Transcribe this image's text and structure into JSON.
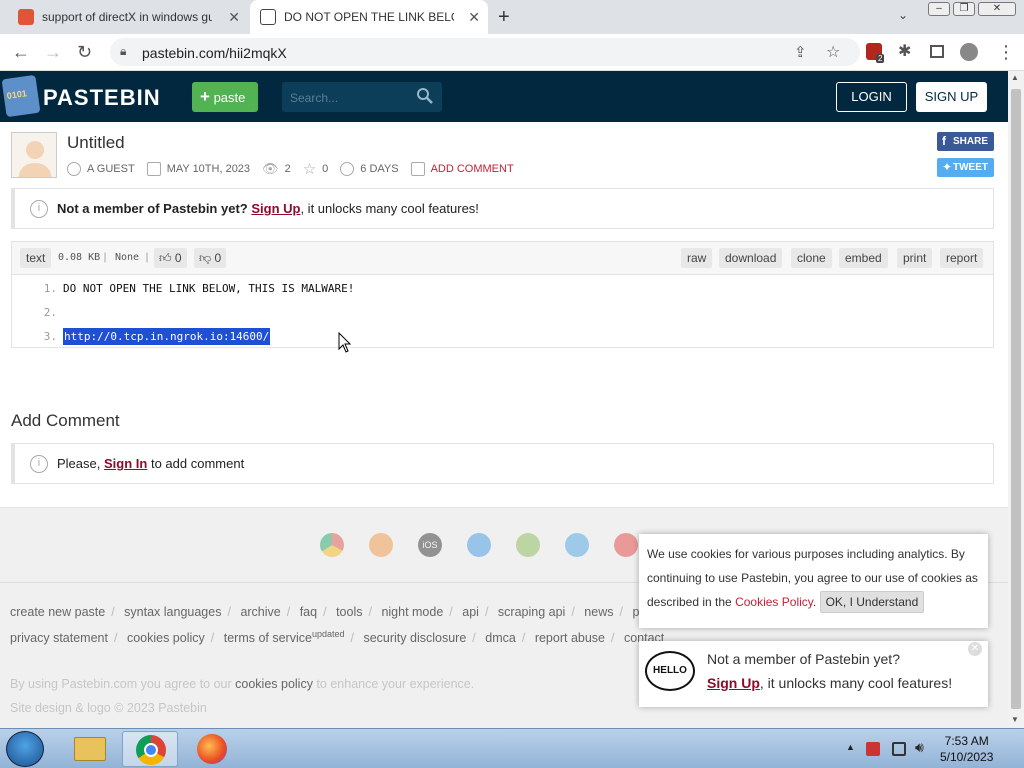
{
  "browser": {
    "tabs": [
      {
        "title": "support of directX in windows gu",
        "active": false
      },
      {
        "title": "DO NOT OPEN THE LINK BELOW, T",
        "active": true
      }
    ],
    "new_tab": "+",
    "url": "pastebin.com/hii2mqkX",
    "extension_badge": "2"
  },
  "header": {
    "logo": "PASTEBIN",
    "paste_button": "paste",
    "search_placeholder": "Search...",
    "login": "LOGIN",
    "signup": "SIGN UP"
  },
  "paste": {
    "title": "Untitled",
    "author": "A GUEST",
    "date": "MAY 10TH, 2023",
    "views": "2",
    "stars": "0",
    "expires": "6 DAYS",
    "add_comment": "ADD COMMENT",
    "share": "SHARE",
    "tweet": "TWEET",
    "syntax": "text",
    "size": "0.08 KB",
    "category": "None",
    "likes": "0",
    "dislikes": "0",
    "actions": [
      "raw",
      "download",
      "clone",
      "embed",
      "print",
      "report"
    ],
    "lines": [
      {
        "num": "1.",
        "text": "DO NOT OPEN THE LINK BELOW, THIS IS MALWARE!"
      },
      {
        "num": "2.",
        "text": ""
      },
      {
        "num": "3.",
        "text": "http://0.tcp.in.ngrok.io:14600/"
      }
    ]
  },
  "notice": {
    "bold": "Not a member of Pastebin yet?",
    "link": "Sign Up",
    "rest": ", it unlocks many cool features!"
  },
  "comments": {
    "heading": "Add Comment",
    "please": "Please,",
    "signin": "Sign In",
    "rest": "to add comment"
  },
  "footer": {
    "links_row1": [
      "create new paste",
      "syntax languages",
      "archive",
      "faq",
      "tools",
      "night mode",
      "api",
      "scraping api",
      "news",
      "pro"
    ],
    "links_row2": [
      "privacy statement",
      "cookies policy",
      "terms of service",
      "security disclosure",
      "dmca",
      "report abuse",
      "contact"
    ],
    "updated_sup": "updated",
    "agree_pre": "By using Pastebin.com you agree to our",
    "agree_link": "cookies policy",
    "agree_post": "to enhance your experience.",
    "copyright": "Site design & logo © 2023 Pastebin"
  },
  "cookie_popup": {
    "text": "We use cookies for various purposes including analytics. By continuing to use Pastebin, you agree to our use of cookies as described in the",
    "link": "Cookies Policy",
    "button": "OK, I Understand"
  },
  "member_popup": {
    "hello": "HELLO",
    "line1": "Not a member of Pastebin yet?",
    "link": "Sign Up",
    "line2_rest": ", it unlocks many cool features!"
  },
  "taskbar": {
    "time": "7:53 AM",
    "date": "5/10/2023"
  },
  "colors": {
    "header_bg": "#02283f",
    "paste_green": "#52b352",
    "accent_red": "#c71f37",
    "selection": "#1e4fd4"
  }
}
